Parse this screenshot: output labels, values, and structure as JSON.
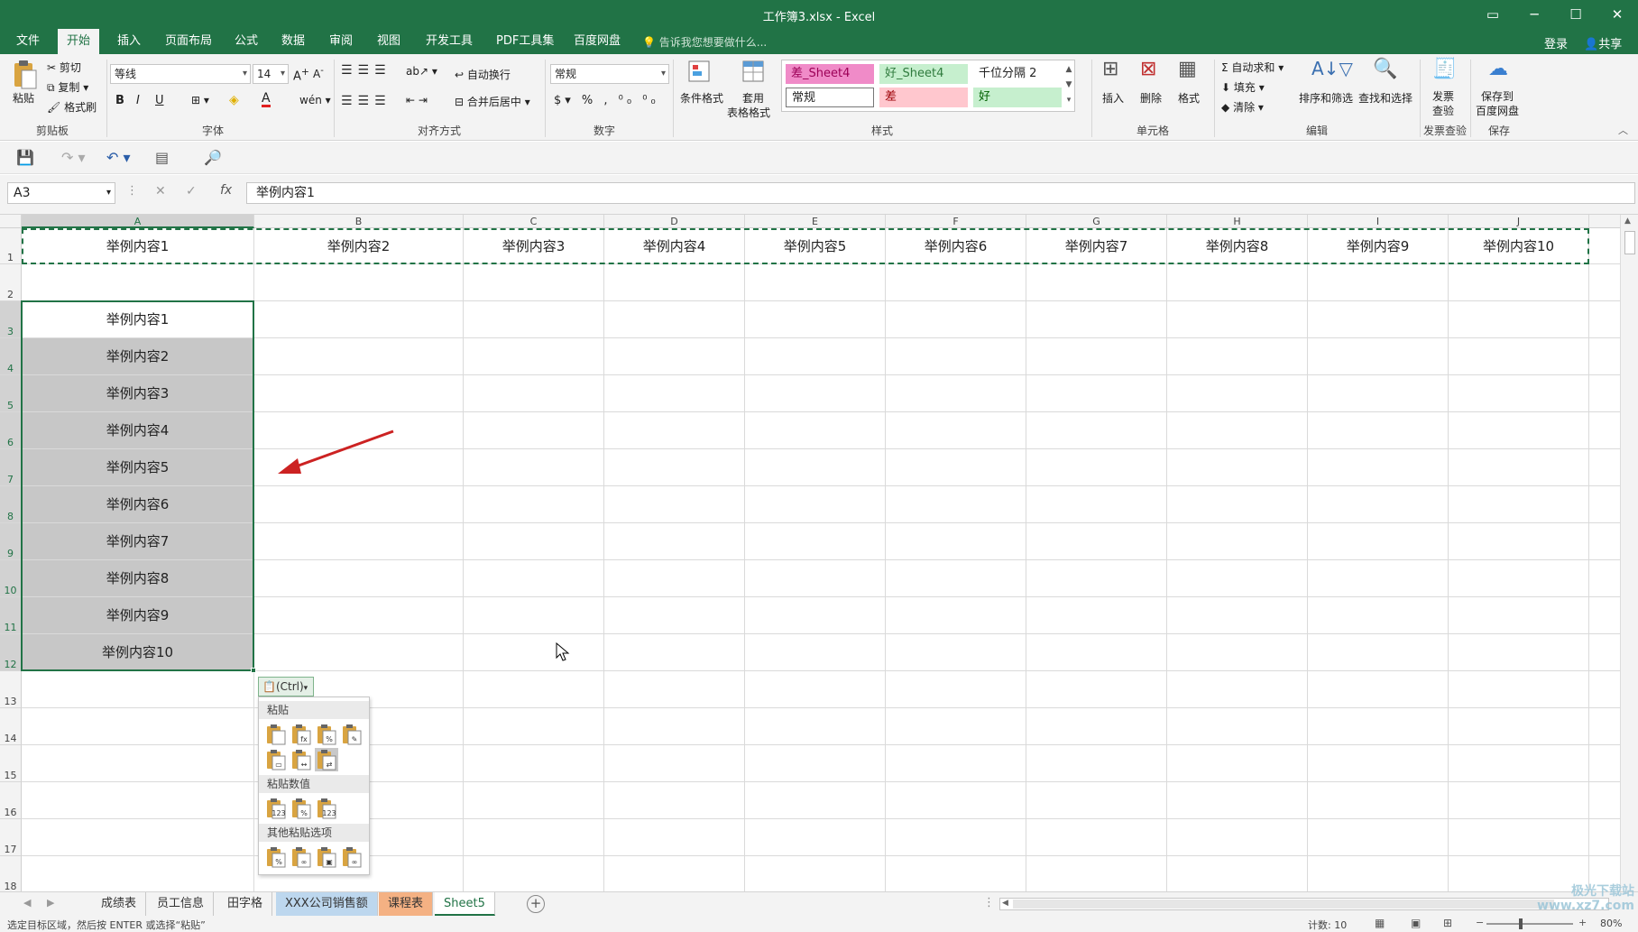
{
  "window": {
    "title": "工作簿3.xlsx - Excel",
    "controls": [
      "ribbon-display-icon",
      "minimize-icon",
      "maximize-icon",
      "close-icon"
    ]
  },
  "tabs": [
    "文件",
    "开始",
    "插入",
    "页面布局",
    "公式",
    "数据",
    "审阅",
    "视图",
    "开发工具",
    "PDF工具集",
    "百度网盘"
  ],
  "active_tab": "开始",
  "tell_me": "告诉我您想要做什么...",
  "account": {
    "login": "登录",
    "share": "共享"
  },
  "ribbon": {
    "clipboard": {
      "label": "剪贴板",
      "paste": "粘贴",
      "cut": "剪切",
      "copy": "复制",
      "format_painter": "格式刷"
    },
    "font": {
      "label": "字体",
      "name": "等线",
      "size": "14",
      "bold": "B",
      "italic": "I",
      "underline": "U"
    },
    "alignment": {
      "label": "对齐方式",
      "wrap": "自动换行",
      "merge": "合并后居中"
    },
    "number": {
      "label": "数字",
      "format": "常规"
    },
    "styles": {
      "label": "样式",
      "conditional": "条件格式",
      "table_format_1": "套用",
      "table_format_2": "表格格式",
      "cells": [
        "差_Sheet4",
        "好_Sheet4",
        "千位分隔 2",
        "常规",
        "差",
        "好"
      ]
    },
    "cells": {
      "label": "单元格",
      "insert": "插入",
      "delete": "删除",
      "format": "格式"
    },
    "editing": {
      "label": "编辑",
      "autosum": "自动求和",
      "fill": "填充",
      "clear": "清除",
      "sort": "排序和筛选",
      "find": "查找和选择"
    },
    "invoice": {
      "label": "发票查验",
      "btn1": "发票",
      "btn2": "查验"
    },
    "save": {
      "label": "保存",
      "btn1": "保存到",
      "btn2": "百度网盘"
    }
  },
  "name_box": "A3",
  "formula": "举例内容1",
  "columns": [
    "A",
    "B",
    "C",
    "D",
    "E",
    "F",
    "G",
    "H",
    "I",
    "J"
  ],
  "rows": [
    "1",
    "2",
    "3",
    "4",
    "5",
    "6",
    "7",
    "8",
    "9",
    "10",
    "11",
    "12",
    "13",
    "14",
    "15",
    "16",
    "17",
    "18"
  ],
  "row1": [
    "举例内容1",
    "举例内容2",
    "举例内容3",
    "举例内容4",
    "举例内容5",
    "举例内容6",
    "举例内容7",
    "举例内容8",
    "举例内容9",
    "举例内容10"
  ],
  "colA": [
    "举例内容1",
    "举例内容2",
    "举例内容3",
    "举例内容4",
    "举例内容5",
    "举例内容6",
    "举例内容7",
    "举例内容8",
    "举例内容9",
    "举例内容10"
  ],
  "paste_options": {
    "button": "(Ctrl)",
    "sec1": "粘贴",
    "sec2": "粘贴数值",
    "sec3": "其他粘贴选项"
  },
  "sheets": [
    "成绩表",
    "员工信息",
    "田字格",
    "XXX公司销售额",
    "课程表",
    "Sheet5"
  ],
  "active_sheet": "Sheet5",
  "sheet_colors": {
    "XXX公司销售额": "#bdd7ee",
    "课程表": "#f4b183"
  },
  "status": {
    "message": "选定目标区域，然后按 ENTER 或选择“粘贴”",
    "count": "计数: 10",
    "zoom": "80%"
  },
  "watermark": "极光下载站 www.xz7.com",
  "colors": {
    "accent": "#217346",
    "selection_gray": "#c7c7c7",
    "arrow": "#cc2222"
  }
}
